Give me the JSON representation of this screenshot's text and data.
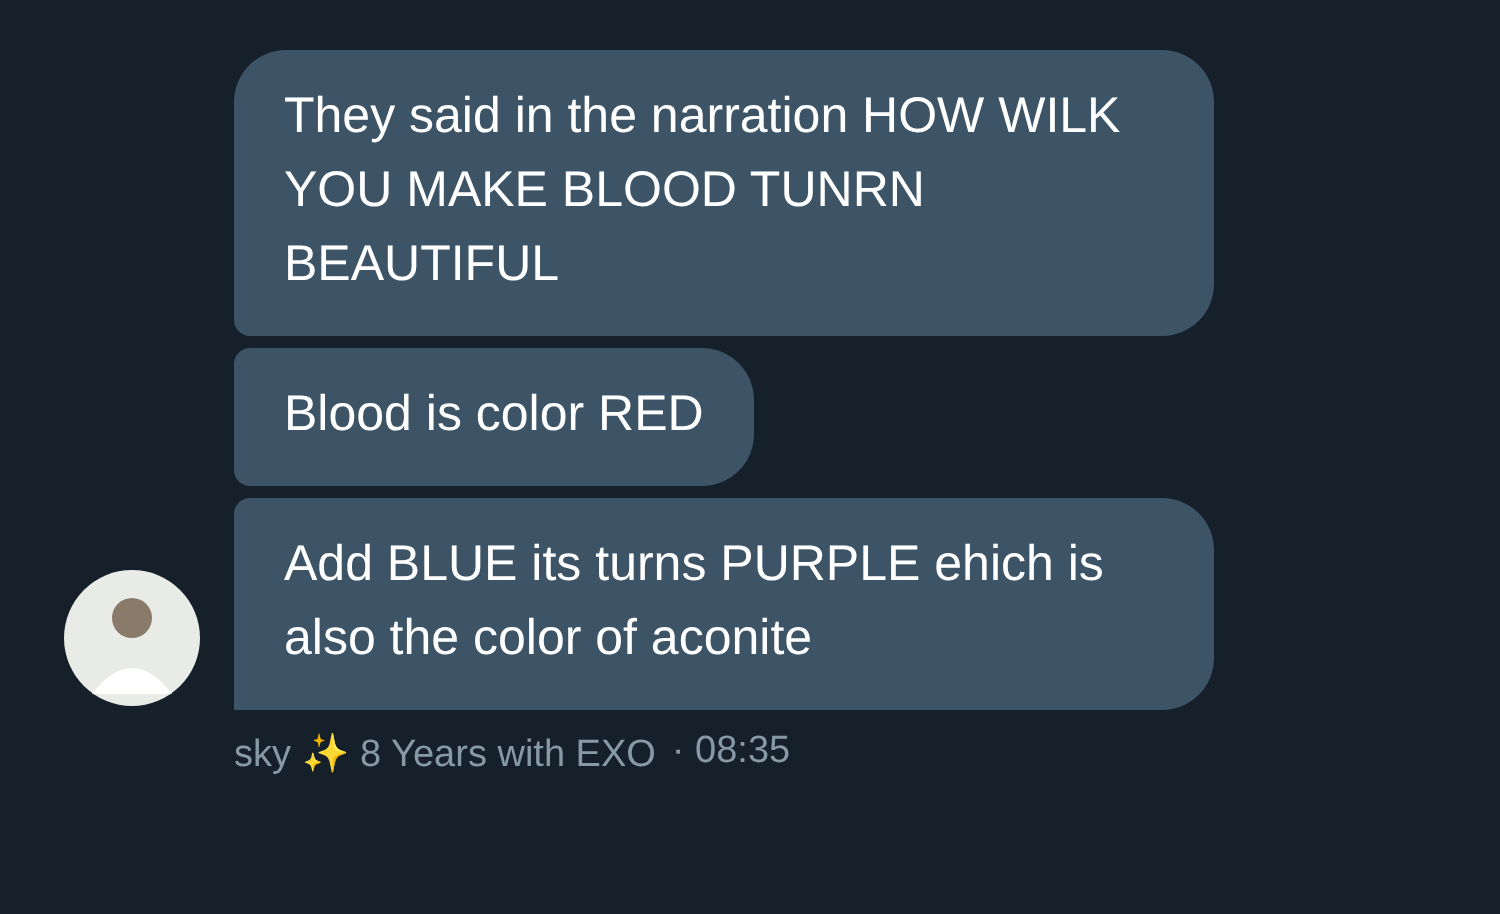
{
  "messages": [
    {
      "text": "They said in the narration HOW WILK YOU MAKE BLOOD TUNRN BEAUTIFUL"
    },
    {
      "text": "Blood is color RED"
    },
    {
      "text": "Add BLUE its turns PURPLE ehich is also the color of aconite"
    }
  ],
  "sender": {
    "name": "sky ✨ 8 Years with EXO",
    "time": "· 08:35"
  }
}
